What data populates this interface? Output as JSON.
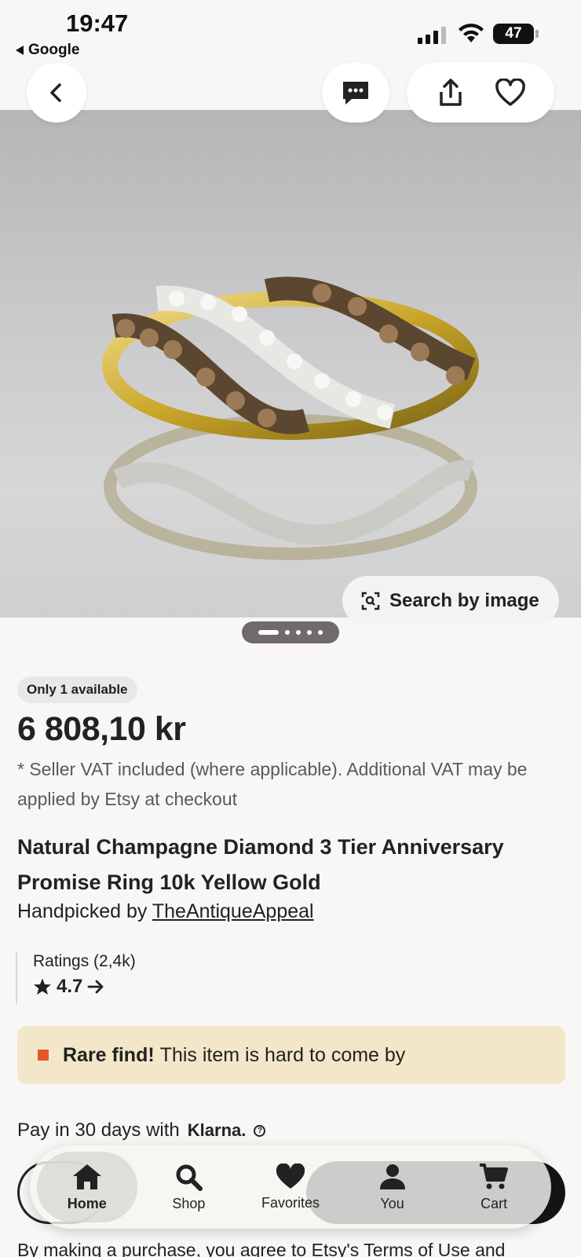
{
  "status_bar": {
    "time": "19:47",
    "back_app": "Google",
    "battery": "47"
  },
  "header_buttons": {
    "back_icon": "chevron-left-icon",
    "message_icon": "message-icon",
    "share_icon": "share-icon",
    "favorite_icon": "heart-icon"
  },
  "gallery": {
    "search_by_image_label": "Search by image",
    "page_count": 5,
    "current_page": 1
  },
  "listing": {
    "availability_badge": "Only 1 available",
    "price": "6 808,10 kr",
    "vat_note": "* Seller VAT included (where applicable). Additional VAT may be applied by Etsy at checkout",
    "title": "Natural Champagne Diamond 3 Tier Anniversary Promise Ring 10k Yellow Gold",
    "handpicked_prefix": "Handpicked by ",
    "shop_name": "TheAntiqueAppeal"
  },
  "ratings": {
    "label": "Ratings (2,4k)",
    "value": "4.7"
  },
  "rare_find": {
    "bold": "Rare find!",
    "text": "This item is hard to come by"
  },
  "payment": {
    "text": "Pay in 30 days with",
    "provider": "Klarna."
  },
  "tabbar": {
    "tabs": [
      {
        "label": "Home",
        "icon": "home-icon",
        "active": true
      },
      {
        "label": "Shop",
        "icon": "search-icon",
        "active": false
      },
      {
        "label": "Favorites",
        "icon": "heart-icon",
        "active": false
      },
      {
        "label": "You",
        "icon": "person-icon",
        "active": false
      },
      {
        "label": "Cart",
        "icon": "cart-icon",
        "active": false
      }
    ]
  },
  "terms": "By making a purchase, you agree to Etsy's Terms of Use and",
  "colors": {
    "background": "#f8f7f5",
    "rare_find_bg": "#f2e7c9",
    "rare_find_marker": "#e9552b",
    "text": "#222222"
  }
}
